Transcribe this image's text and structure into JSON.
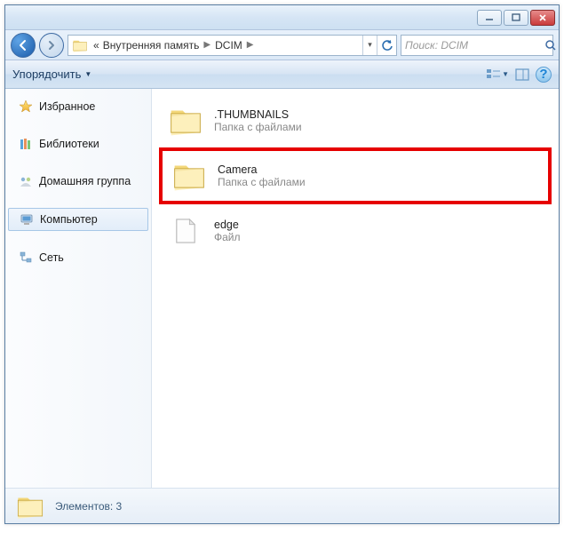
{
  "titlebar": {
    "minimize": "–",
    "maximize": "▢",
    "close": "✕"
  },
  "nav": {
    "breadcrumb_prefix": "«",
    "breadcrumb_1": "Внутренняя память",
    "breadcrumb_2": "DCIM",
    "search_placeholder": "Поиск: DCIM"
  },
  "toolbar": {
    "organize": "Упорядочить"
  },
  "sidebar": {
    "favorites": "Избранное",
    "libraries": "Библиотеки",
    "homegroup": "Домашняя группа",
    "computer": "Компьютер",
    "network": "Сеть"
  },
  "files": [
    {
      "name": ".THUMBNAILS",
      "sub": "Папка с файлами",
      "type": "folder",
      "highlight": false
    },
    {
      "name": "Camera",
      "sub": "Папка с файлами",
      "type": "folder",
      "highlight": true
    },
    {
      "name": "edge",
      "sub": "Файл",
      "type": "file",
      "highlight": false
    }
  ],
  "status": {
    "text": "Элементов: 3"
  }
}
